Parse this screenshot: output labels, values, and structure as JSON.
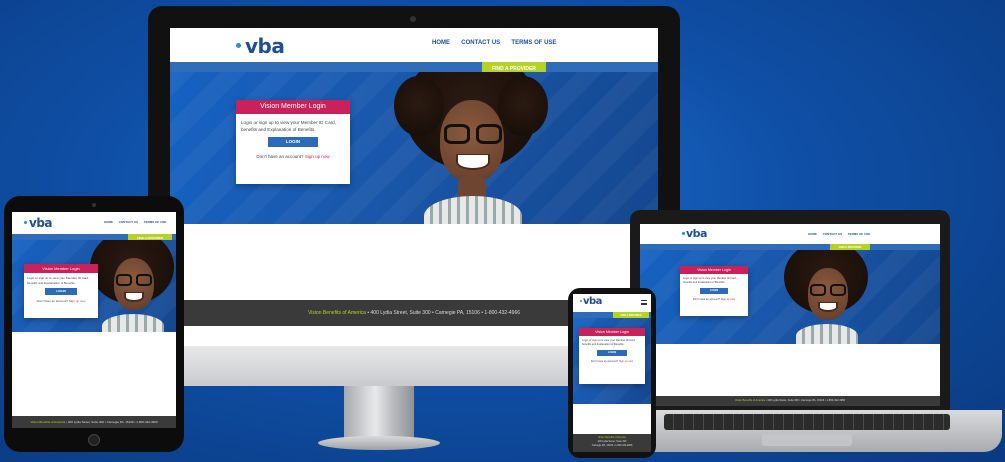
{
  "site": {
    "logo": "vba",
    "nav": [
      "HOME",
      "CONTACT US",
      "TERMS OF USE"
    ],
    "find_provider": "FIND A PROVIDER",
    "login_card": {
      "title": "Vision Member Login",
      "body": "Login or sign up to view your Member ID Card, benefits and Explanation of Benefits.",
      "button": "LOGIN",
      "foot_prefix": "Don't have an account?",
      "foot_link": "Sign up now"
    },
    "footer": {
      "brand": "Vision Benefits of America",
      "address": "400 Lydia Street, Suite 300",
      "city": "Carnegie PA, 15106",
      "phone": "1-800-432-4966",
      "sep": "•"
    }
  },
  "colors": {
    "background": "#0f4fa6",
    "brand_blue": "#1d4f9c",
    "login_pink": "#c8215b",
    "find_provider_green": "#b7d227",
    "footer_gray": "#3a3a3a"
  },
  "devices": [
    "desktop-monitor",
    "tablet",
    "laptop",
    "phone"
  ]
}
